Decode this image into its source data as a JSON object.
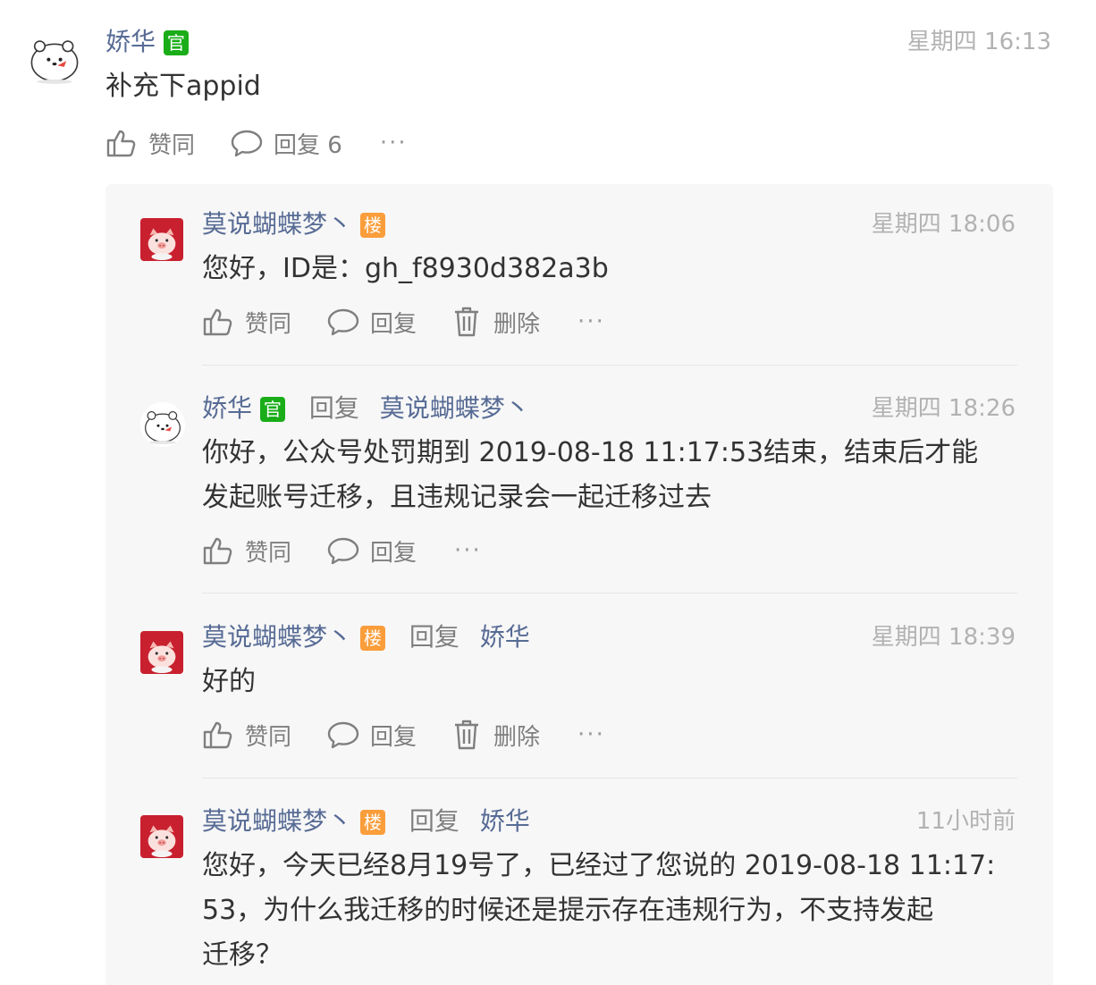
{
  "main_comment": {
    "author": "娇华",
    "badge": "官",
    "time": "星期四 16:13",
    "content": "补充下appid",
    "like_label": "赞同",
    "reply_label": "回复 6",
    "more": "···"
  },
  "replies": [
    {
      "author": "莫说蝴蝶梦丶",
      "badge": "楼",
      "time": "星期四 18:06",
      "content": [
        "您好，ID是：gh_f8930d382a3b"
      ],
      "like_label": "赞同",
      "reply_label": "回复",
      "delete_label": "删除",
      "more": "···"
    },
    {
      "author": "娇华",
      "badge": "官",
      "reply_word": "回复",
      "reply_to": "莫说蝴蝶梦丶",
      "time": "星期四 18:26",
      "content": [
        "你好，公众号处罚期到 2019-08-18 11:17:53结束，结束后才能",
        "发起账号迁移，且违规记录会一起迁移过去"
      ],
      "like_label": "赞同",
      "reply_label": "回复",
      "more": "···"
    },
    {
      "author": "莫说蝴蝶梦丶",
      "badge": "楼",
      "reply_word": "回复",
      "reply_to": "娇华",
      "time": "星期四 18:39",
      "content": [
        "好的"
      ],
      "like_label": "赞同",
      "reply_label": "回复",
      "delete_label": "删除",
      "more": "···"
    },
    {
      "author": "莫说蝴蝶梦丶",
      "badge": "楼",
      "reply_word": "回复",
      "reply_to": "娇华",
      "time": "11小时前",
      "content": [
        "您好，今天已经8月19号了，已经过了您说的 2019-08-18 11:17:",
        "53，为什么我迁移的时候还是提示存在违规行为，不支持发起",
        "迁移？"
      ]
    }
  ],
  "colors": {
    "name_blue": "#576b95",
    "official_green": "#1aad19",
    "floor_orange": "#fa9d3b",
    "reply_bg": "#f7f7f7",
    "muted": "#b2b2b2"
  },
  "icons": {
    "like": "thumbs-up-icon",
    "reply": "speech-bubble-icon",
    "delete": "trash-icon",
    "more": "more-dots-icon"
  }
}
